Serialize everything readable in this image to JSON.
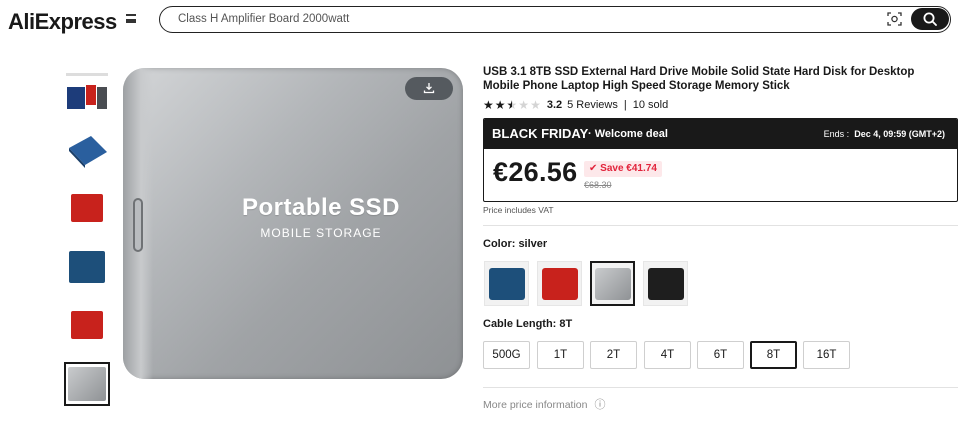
{
  "header": {
    "logo": "AliExpress",
    "search_value": "Class H Amplifier Board 2000watt"
  },
  "thumbnails": [
    {
      "name": "thumb-multi",
      "color": "#1d3c7a"
    },
    {
      "name": "thumb-blue-angle",
      "color": "#2a5f9e"
    },
    {
      "name": "thumb-red",
      "color": "#c8221c"
    },
    {
      "name": "thumb-blue",
      "color": "#1d4f7a"
    },
    {
      "name": "thumb-red-2",
      "color": "#c8221c"
    },
    {
      "name": "thumb-silver",
      "color": "#a7a9ac",
      "selected": true
    }
  ],
  "main_image": {
    "title": "Portable SSD",
    "subtitle": "MOBILE STORAGE"
  },
  "product": {
    "title": "USB 3.1 8TB SSD External Hard Drive Mobile Solid State Hard Disk for Desktop Mobile Phone Laptop High Speed Storage Memory Stick",
    "rating": "3.2",
    "reviews": "5 Reviews",
    "sold": "10 sold",
    "separator": "|"
  },
  "deal": {
    "name": "BLACK FRIDAY",
    "sub": "· Welcome deal",
    "ends_label": "Ends :",
    "ends_value": "Dec 4, 09:59 (GMT+2)",
    "price": "€26.56",
    "save": "Save €41.74",
    "old_price": "€68.30",
    "vat": "Price includes VAT"
  },
  "color": {
    "label": "Color: silver",
    "options": [
      {
        "name": "blue",
        "hex": "#1d4f7a"
      },
      {
        "name": "red",
        "hex": "#c8221c"
      },
      {
        "name": "silver",
        "hex": "#a7a9ac",
        "selected": true
      },
      {
        "name": "black",
        "hex": "#1e1e1e"
      }
    ]
  },
  "cable": {
    "label": "Cable Length: 8T",
    "options": [
      "500G",
      "1T",
      "2T",
      "4T",
      "6T",
      "8T",
      "16T"
    ],
    "selected": "8T"
  },
  "more_price": {
    "label": "More price information",
    "icon": "ⓘ"
  },
  "colors": {
    "accent": "#191919",
    "sale_red": "#e2233b",
    "sale_bg": "#fde8ea"
  }
}
